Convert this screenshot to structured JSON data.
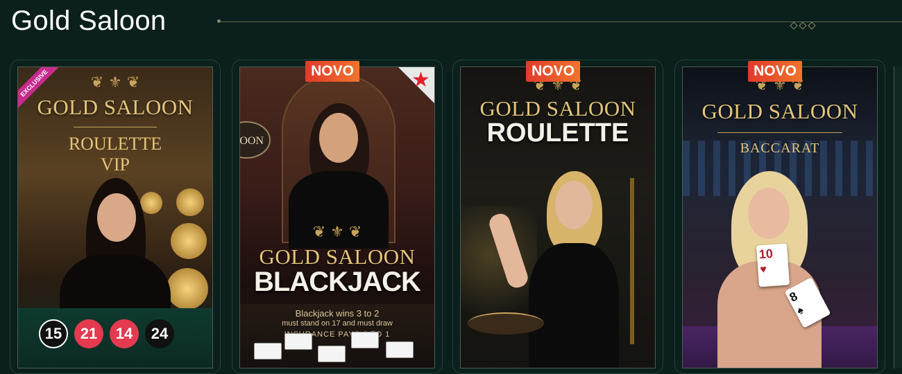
{
  "section": {
    "title": "Gold Saloon"
  },
  "games": [
    {
      "brand": "GOLD SALOON",
      "subtitle_line1": "ROULETTE",
      "subtitle_line2": "VIP",
      "ribbon": "EXCLUSIVE",
      "results": [
        "15",
        "21",
        "14",
        "24"
      ]
    },
    {
      "badge": "NOVO",
      "corner_logo": "OON",
      "brand": "GOLD SALOON",
      "subtitle": "BLACKJACK",
      "info_line1": "Blackjack wins 3 to 2",
      "info_line2": "must stand on 17 and must draw",
      "info_line3": "INSURANCE PAYS 2 TO 1"
    },
    {
      "badge": "NOVO",
      "brand": "GOLD SALOON",
      "subtitle": "ROULETTE"
    },
    {
      "badge": "NOVO",
      "brand": "GOLD SALOON",
      "subtitle": "BACCARAT",
      "card1": "10",
      "card2": "8"
    }
  ],
  "colors": {
    "background": "#0b1f1c",
    "gold": "#e4c57a",
    "novo_badge": "#e23a2b",
    "exclusive_ribbon": "#c62c8e",
    "result_red": "#e33a4f"
  }
}
